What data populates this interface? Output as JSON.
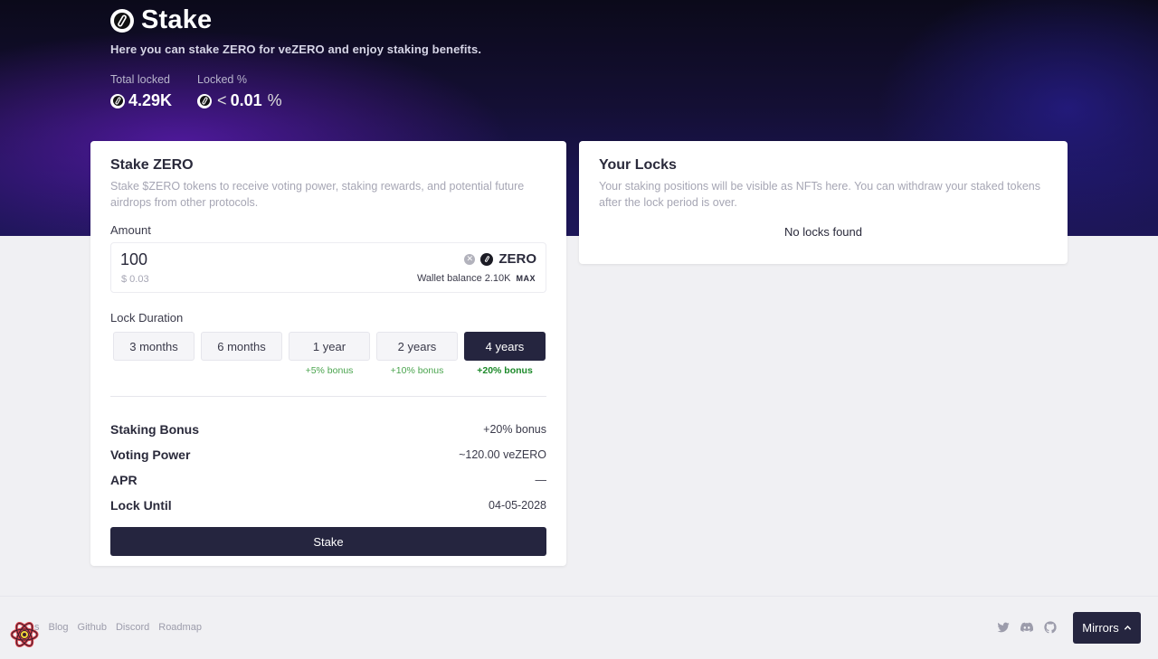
{
  "header": {
    "title": "Stake",
    "subtitle": "Here you can stake ZERO for veZERO and enjoy staking benefits.",
    "stats": {
      "total_locked_label": "Total locked",
      "total_locked_value": "4.29K",
      "locked_pct_label": "Locked %",
      "locked_pct_prefix": "<",
      "locked_pct_value": "0.01",
      "locked_pct_suffix": "%"
    }
  },
  "stake_card": {
    "title": "Stake ZERO",
    "description": "Stake $ZERO tokens to receive voting power, staking rewards, and potential future airdrops from other protocols.",
    "amount_label": "Amount",
    "amount_value": "100",
    "amount_usd": "$ 0.03",
    "token_name": "ZERO",
    "wallet_balance": "Wallet balance 2.10K",
    "max_label": "MAX",
    "duration_label": "Lock Duration",
    "durations": [
      {
        "label": "3 months",
        "bonus": ""
      },
      {
        "label": "6 months",
        "bonus": ""
      },
      {
        "label": "1 year",
        "bonus": "+5% bonus"
      },
      {
        "label": "2 years",
        "bonus": "+10% bonus"
      },
      {
        "label": "4 years",
        "bonus": "+20% bonus"
      }
    ],
    "selected_duration": "4 years",
    "summary": [
      {
        "label": "Staking Bonus",
        "value": "+20% bonus"
      },
      {
        "label": "Voting Power",
        "value": "~120.00 veZERO"
      },
      {
        "label": "APR",
        "value": "—"
      },
      {
        "label": "Lock Until",
        "value": "04-05-2028"
      }
    ],
    "stake_button": "Stake"
  },
  "locks_card": {
    "title": "Your Locks",
    "description": "Your staking positions will be visible as NFTs here. You can withdraw your staked tokens after the lock period is over.",
    "empty_text": "No locks found"
  },
  "footer": {
    "links": [
      "s",
      "Blog",
      "Github",
      "Discord",
      "Roadmap"
    ],
    "social_icons": [
      "twitter-icon",
      "discord-icon",
      "github-icon"
    ],
    "mirrors_button": "Mirrors"
  },
  "colors": {
    "accent_dark": "#25253f",
    "bonus_green": "#4aa44e",
    "hero_purple": "#581aaa"
  }
}
